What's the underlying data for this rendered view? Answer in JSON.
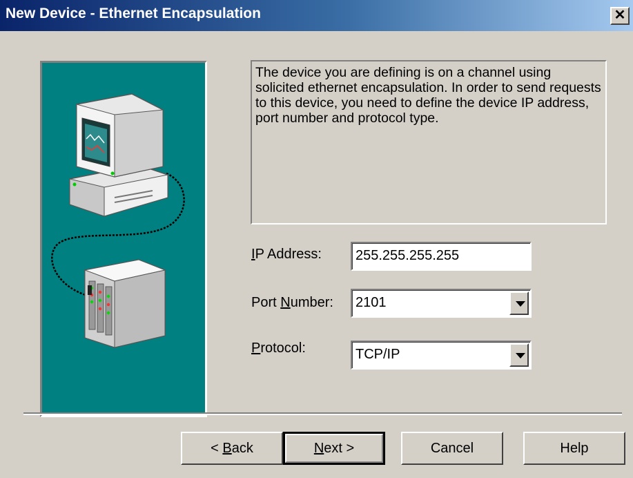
{
  "window": {
    "title": "New Device - Ethernet Encapsulation",
    "close_label": "✕"
  },
  "description": "The device you are defining is on a channel using solicited ethernet encapsulation.  In order to send requests to this device, you need to define the device IP address, port number and protocol type.",
  "form": {
    "ip_label_mnemonic": "I",
    "ip_label_rest": "P Address:",
    "ip_value": "255.255.255.255",
    "port_label_pre": "Port ",
    "port_label_mnemonic": "N",
    "port_label_rest": "umber:",
    "port_value": "2101",
    "protocol_label_mnemonic": "P",
    "protocol_label_rest": "rotocol:",
    "protocol_value": "TCP/IP"
  },
  "buttons": {
    "back_pre": "< ",
    "back_mnemonic": "B",
    "back_rest": "ack",
    "next_mnemonic": "N",
    "next_rest": "ext >",
    "cancel": "Cancel",
    "help": "Help"
  },
  "colors": {
    "dialog_bg": "#d4d0c8",
    "illustration_bg": "#008080",
    "titlebar_start": "#0a246a",
    "titlebar_end": "#a6caf0"
  }
}
